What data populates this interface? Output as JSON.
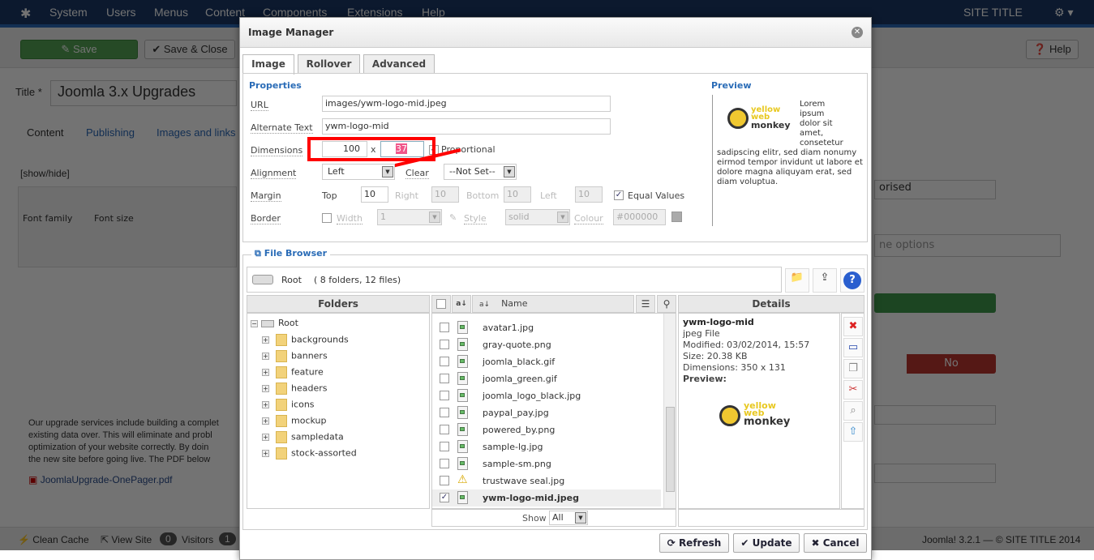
{
  "topnav": {
    "menu": [
      "System",
      "Users",
      "Menus",
      "Content",
      "Components",
      "Extensions",
      "Help"
    ],
    "site_title": "SITE TITLE"
  },
  "toolbar": {
    "save": "Save",
    "save_close": "Save & Close",
    "help": "Help"
  },
  "article": {
    "title_label": "Title *",
    "title_value": "Joomla 3.x Upgrades",
    "tabs": [
      "Content",
      "Publishing",
      "Images and links"
    ],
    "show_hide": "[show/hide]",
    "font_family": "Font family",
    "font_size": "Font size",
    "body_lines": [
      "Our upgrade services include building a complet",
      "existing data over.  This will eliminate and probl",
      "optimization of your website correctly.  By doin",
      "the new site before going live.  The PDF below"
    ],
    "pdf_link": "JoomlaUpgrade-OnePager.pdf"
  },
  "sidebar": {
    "status_partial": "orised",
    "tags_placeholder_partial": "ne options",
    "toggle_no": "No"
  },
  "statusbar": {
    "clean_cache": "Clean Cache",
    "view_site": "View Site",
    "visitors_count": "0",
    "visitors": "Visitors",
    "admins_count": "1",
    "footer": "Joomla! 3.2.1 — © SITE TITLE 2014"
  },
  "dialog": {
    "title": "Image Manager",
    "tabs": [
      "Image",
      "Rollover",
      "Advanced"
    ],
    "properties": {
      "heading": "Properties",
      "url_label": "URL",
      "url": "images/ywm-logo-mid.jpeg",
      "alt_label": "Alternate Text",
      "alt": "ywm-logo-mid",
      "dim_label": "Dimensions",
      "width": "100",
      "x": "x",
      "height": "37",
      "proportional": "Proportional",
      "align_label": "Alignment",
      "align": "Left",
      "clear_label": "Clear",
      "clear": "--Not Set--",
      "margin_label": "Margin",
      "top_label": "Top",
      "top": "10",
      "right_label": "Right",
      "right": "10",
      "bottom_label": "Bottom",
      "bottom": "10",
      "left_label": "Left",
      "left": "10",
      "equal": "Equal Values",
      "border_label": "Border",
      "bwidth_label": "Width",
      "bwidth": "1",
      "style_label": "Style",
      "style": "solid",
      "colour_label": "Colour",
      "colour": "#000000"
    },
    "preview": {
      "heading": "Preview",
      "text_top": [
        "Lorem",
        "ipsum",
        "dolor sit",
        "amet,",
        "consetetur"
      ],
      "text_bottom": "sadipscing elitr, sed diam nonumy eirmod tempor invidunt ut labore et dolore magna aliquyam erat, sed diam voluptua.",
      "logo": "yellow web monkey"
    },
    "file_browser": {
      "heading": "File Browser",
      "root": "Root",
      "summary": "( 8 folders, 12 files)",
      "folders_header": "Folders",
      "name_header": "Name",
      "details_header": "Details",
      "folders": [
        "backgrounds",
        "banners",
        "feature",
        "headers",
        "icons",
        "mockup",
        "sampledata",
        "stock-assorted"
      ],
      "files": [
        {
          "name": "avatar1.jpg"
        },
        {
          "name": "gray-quote.png"
        },
        {
          "name": "joomla_black.gif"
        },
        {
          "name": "joomla_green.gif"
        },
        {
          "name": "joomla_logo_black.jpg"
        },
        {
          "name": "paypal_pay.jpg"
        },
        {
          "name": "powered_by.png"
        },
        {
          "name": "sample-lg.jpg"
        },
        {
          "name": "sample-sm.png"
        },
        {
          "name": "trustwave seal.jpg",
          "warning": true
        },
        {
          "name": "ywm-logo-mid.jpeg",
          "selected": true
        }
      ],
      "show_label": "Show",
      "show": "All",
      "details": {
        "name": "ywm-logo-mid",
        "type": "jpeg File",
        "modified": "Modified: 03/02/2014, 15:57",
        "size": "Size: 20.38 KB",
        "dimensions": "Dimensions: 350 x 131",
        "preview": "Preview:"
      }
    },
    "buttons": {
      "refresh": "Refresh",
      "update": "Update",
      "cancel": "Cancel"
    },
    "colors": {
      "accent": "#2a6cb7",
      "highlight": "#ff0000",
      "save_green": "#4a9a4a"
    }
  }
}
